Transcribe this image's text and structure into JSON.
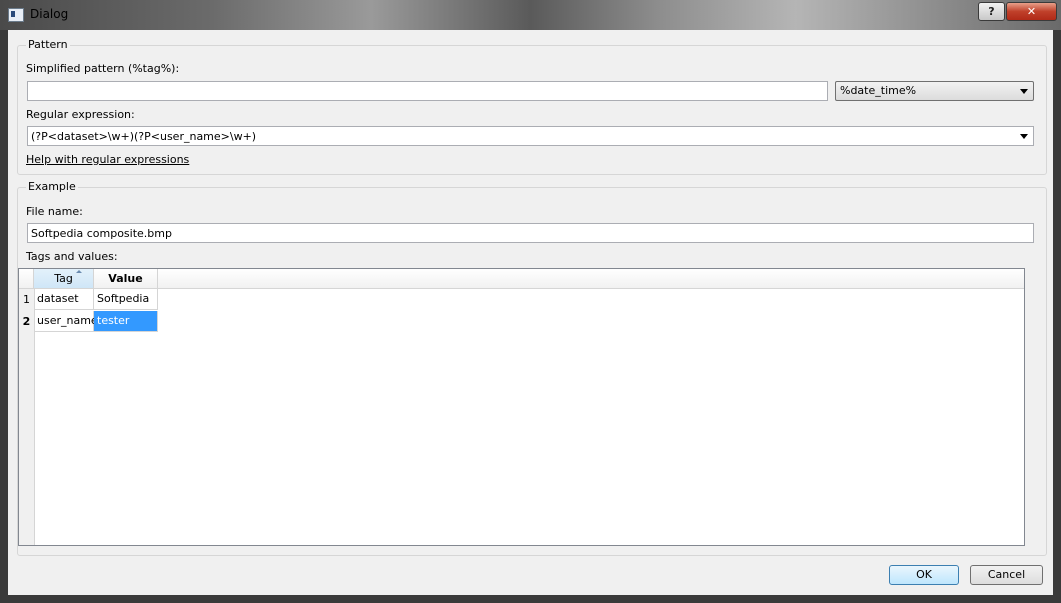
{
  "window": {
    "title": "Dialog",
    "help_label": "?",
    "close_label": "✕"
  },
  "pattern": {
    "group_title": "Pattern",
    "simplified_label": "Simplified pattern (%tag%):",
    "simplified_value": "",
    "tag_select": "%date_time%",
    "regex_label": "Regular expression:",
    "regex_value": "(?P<dataset>\\w+)(?P<user_name>\\w+)",
    "help_link": "Help with regular expressions"
  },
  "example": {
    "group_title": "Example",
    "file_label": "File name:",
    "file_value": "Softpedia composite.bmp",
    "tags_label": "Tags and values:",
    "table": {
      "columns": [
        "Tag",
        "Value"
      ],
      "rows": [
        {
          "num": "1",
          "tag": "dataset",
          "value": "Softpedia"
        },
        {
          "num": "2",
          "tag": "user_name",
          "value": "tester"
        }
      ]
    }
  },
  "buttons": {
    "ok": "OK",
    "cancel": "Cancel"
  }
}
